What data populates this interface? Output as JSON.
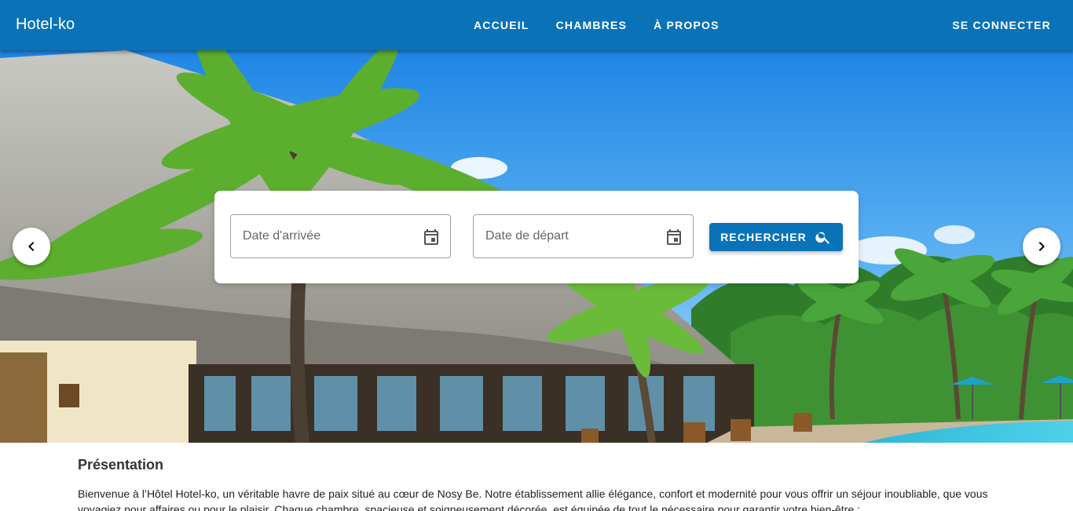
{
  "header": {
    "brand": "Hotel-ko",
    "nav": [
      {
        "label": "ACCUEIL"
      },
      {
        "label": "CHAMBRES"
      },
      {
        "label": "À PROPOS"
      }
    ],
    "login_label": "SE CONNECTER"
  },
  "search": {
    "arrival_placeholder": "Date d'arrivée",
    "departure_placeholder": "Date de départ",
    "button_label": "RECHERCHER"
  },
  "presentation": {
    "title": "Présentation",
    "text": "Bienvenue à l’Hôtel Hotel-ko, un véritable havre de paix situé au cœur de Nosy Be. Notre établissement allie élégance, confort et modernité pour vous offrir un séjour inoubliable, que vous voyagiez pour affaires ou pour le plaisir. Chaque chambre, spacieuse et soigneusement décorée, est équipée de tout le nécessaire pour garantir votre bien-être ;"
  },
  "colors": {
    "primary": "#0a73b7",
    "surface": "#ffffff"
  },
  "icons": {
    "prev": "chevron-left-icon",
    "next": "chevron-right-icon",
    "calendar": "calendar-icon",
    "search": "search-icon"
  }
}
